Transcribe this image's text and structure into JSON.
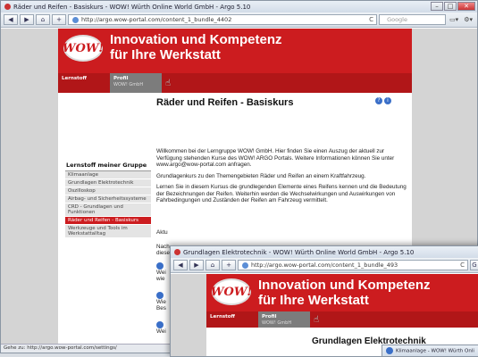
{
  "back_window": {
    "title": "Räder und Reifen - Basiskurs - WOW! Würth Online World GmbH - Argo 5.10",
    "url": "http://argo.wow-portal.com/content_1_bundle_4402",
    "search_placeholder": "Google",
    "header": {
      "line1": "Innovation und Kompetenz",
      "line2": "für Ihre Werkstatt",
      "logo": "WOW!"
    },
    "nav": [
      {
        "label": "Lernstoff",
        "sub": ""
      },
      {
        "label": "Profil",
        "sub": "WOW! GmbH"
      }
    ],
    "page_title": "Räder und Reifen - Basiskurs",
    "sidebar": {
      "title": "Lernstoff meiner Gruppe",
      "items": [
        "Klimaanlage",
        "Grundlagen Elektrotechnik",
        "Oszilloskop",
        "Airbag- und Sicherheitssysteme",
        "CRD - Grundlagen und Funktionen",
        "Räder und Reifen - Basiskurs",
        "Werkzeuge und Tools im Werkstattalltag"
      ]
    },
    "paragraphs": [
      "Willkommen bei der Lerngruppe WOW! GmbH. Hier finden Sie einen Auszug der aktuell zur Verfügung stehenden Kurse des WOW! ARGO Portals. Weitere Informationen können Sie unter www.argo@wow-portal.com anfragen.",
      "Grundlagenkurs zu den Themengebieten Räder und Reifen an einem Kraftfahrzeug.",
      "Lernen Sie in diesem Kursus die grundlegenden Elemente eines Reifens kennen und die Bedeutung der Bezeichnungen der Reifen. Weiterhin werden die Wechselwirkungen und Auswirkungen von Fahrbedingungen und Zuständen der Reifen am Fahrzeug vermittelt."
    ],
    "partial_lines": [
      "Aktu",
      "Nach",
      "diese",
      "Wei",
      "wie",
      "Wie",
      "Bes",
      "Wei"
    ],
    "status": "Gehe zu: http://argo.wow-portal.com/settings/"
  },
  "front_window": {
    "title": "Grundlagen Elektrotechnik - WOW! Würth Online World GmbH - Argo 5.10",
    "url": "http://argo.wow-portal.com/content_1_bundle_493",
    "header": {
      "line1": "Innovation und Kompetenz",
      "line2": "für Ihre Werkstatt",
      "logo": "WOW!"
    },
    "nav": [
      {
        "label": "Lernstoff",
        "sub": ""
      },
      {
        "label": "Profil",
        "sub": "WOW! GmbH"
      }
    ],
    "page_title": "Grundlagen Elektrotechnik",
    "mini_tab": "Klimaanlage - WOW! Würth Onli"
  }
}
